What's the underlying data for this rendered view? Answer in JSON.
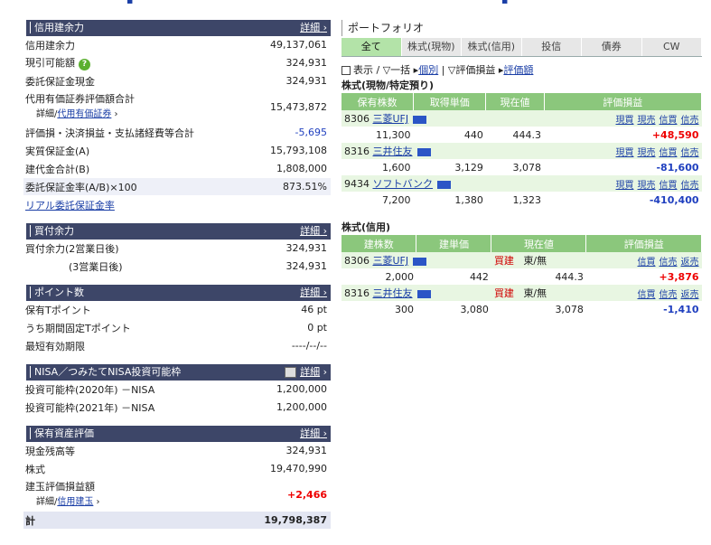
{
  "left": {
    "shinyo": {
      "title": "信用建余力",
      "detail": "詳細",
      "rows": [
        {
          "label": "信用建余力",
          "value": "49,137,061"
        },
        {
          "label": "現引可能額",
          "value": "324,931"
        },
        {
          "label": "委託保証金現金",
          "value": "324,931"
        }
      ],
      "dairi_label": "代用有価証券評価額合計",
      "dairi_sub_prefix": "詳細",
      "dairi_sub_link": "代用有価証券",
      "dairi_value": "15,473,872",
      "rows2": [
        {
          "label": "評価損・決済損益・支払諸経費等合計",
          "value": "-5,695"
        },
        {
          "label": "実質保証金(A)",
          "value": "15,793,108"
        },
        {
          "label": "建代金合計(B)",
          "value": "1,808,000"
        },
        {
          "label": "委託保証金率(A/B)×100",
          "value": "873.51%"
        }
      ],
      "real_link": "リアル委託保証金率"
    },
    "kaitsuke": {
      "title": "買付余力",
      "detail": "詳細",
      "rows": [
        {
          "label": "買付余力(2営業日後)",
          "value": "324,931"
        },
        {
          "label": "(3営業日後)",
          "value": "324,931"
        }
      ]
    },
    "point": {
      "title": "ポイント数",
      "detail": "詳細",
      "rows": [
        {
          "label": "保有Tポイント",
          "value": "46 pt"
        },
        {
          "label": "うち期間固定Tポイント",
          "value": "0 pt"
        },
        {
          "label": "最短有効期限",
          "value": "----/--/--"
        }
      ]
    },
    "nisa": {
      "title": "NISA／つみたてNISA投資可能枠",
      "detail": "詳細",
      "rows": [
        {
          "label": "投資可能枠(2020年)",
          "kind": "－NISA",
          "value": "1,200,000"
        },
        {
          "label": "投資可能枠(2021年)",
          "kind": "－NISA",
          "value": "1,200,000"
        }
      ]
    },
    "hoyu": {
      "title": "保有資産評価",
      "detail": "詳細",
      "rows": [
        {
          "label": "現金残高等",
          "value": "324,931"
        },
        {
          "label": "株式",
          "value": "19,470,990"
        }
      ],
      "tate_label": "建玉評価損益額",
      "tate_sub_prefix": "詳細",
      "tate_sub_link": "信用建玉",
      "tate_value": "+2,466",
      "total_label": "計",
      "total_value": "19,798,387"
    }
  },
  "right": {
    "title": "ポートフォリオ",
    "tabs": [
      "全て",
      "株式(現物)",
      "株式(信用)",
      "投信",
      "債券",
      "CW"
    ],
    "toolbar": {
      "display": "表示",
      "ikkatsu": "一括",
      "kobetsu": "個別",
      "hyoka_soneki": "評価損益",
      "hyoka_gaku": "評価額"
    },
    "genbutsu": {
      "title": "株式(現物/特定預り)",
      "headers": [
        "保有株数",
        "取得単価",
        "現在値",
        "評価損益"
      ],
      "links": [
        "現買",
        "現売",
        "信買",
        "信売"
      ],
      "items": [
        {
          "code": "8306",
          "name": "三菱UFJ",
          "qty": "11,300",
          "cost": "440",
          "price": "444.3",
          "pl": "+48,590"
        },
        {
          "code": "8316",
          "name": "三井住友",
          "qty": "1,600",
          "cost": "3,129",
          "price": "3,078",
          "pl": "-81,600"
        },
        {
          "code": "9434",
          "name": "ソフトバンク",
          "qty": "7,200",
          "cost": "1,380",
          "price": "1,323",
          "pl": "-410,400"
        }
      ]
    },
    "shinyo": {
      "title": "株式(信用)",
      "headers": [
        "建株数",
        "建単価",
        "現在値",
        "評価損益"
      ],
      "links": [
        "信買",
        "信売",
        "返売"
      ],
      "items": [
        {
          "code": "8306",
          "name": "三菱UFJ",
          "side": "買建",
          "market": "東/無",
          "qty": "2,000",
          "cost": "442",
          "price": "444.3",
          "pl": "+3,876"
        },
        {
          "code": "8316",
          "name": "三井住友",
          "side": "買建",
          "market": "東/無",
          "qty": "300",
          "cost": "3,080",
          "price": "3,078",
          "pl": "-1,410"
        }
      ]
    }
  }
}
